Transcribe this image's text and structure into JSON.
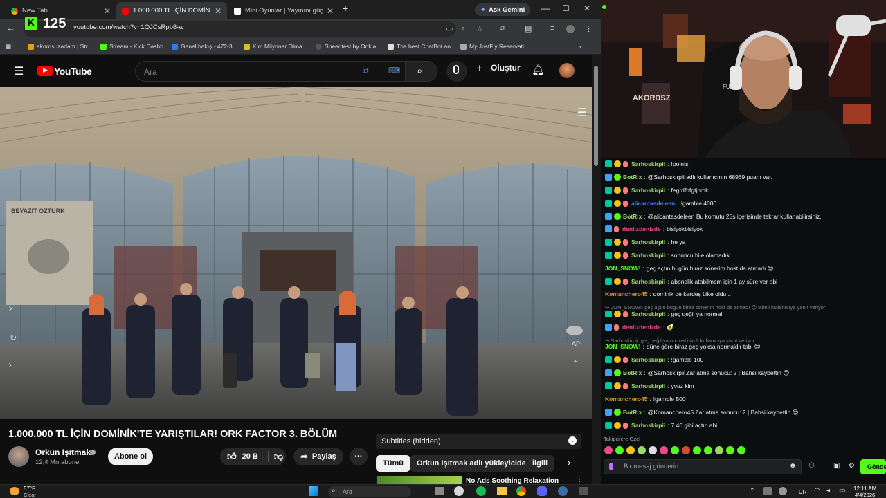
{
  "browser": {
    "tabs": [
      {
        "title": "New Tab",
        "active": false
      },
      {
        "title": "1.000.000 TL İÇİN DOMİNİK'TE",
        "active": true
      },
      {
        "title": "Mini Oyunlar | Yayınını güçlend",
        "active": false
      }
    ],
    "new_tab_symbol": "+",
    "gemini_label": "Ask Gemini",
    "url": "youtube.com/watch?v=1QJCsRpb8-w",
    "bookmarks": [
      "akordsuzadam | Str...",
      "Stream - Kick Dashb...",
      "Genel bakış - 472-3...",
      "Kim Milyoner Olma...",
      "Speedtest by Ookla...",
      "The best ChatBot an...",
      "My JustFly Reservati..."
    ]
  },
  "kick_overlay": {
    "logo": "K",
    "count": "125"
  },
  "youtube": {
    "logo_text": "YouTube",
    "search_placeholder": "Ara",
    "create_label": "Oluştur",
    "video_title": "1.000.000 TL İÇİN DOMİNİK'TE YARIŞTILAR! ORK FACTOR 3. BÖLÜM",
    "channel_name": "Orkun Işıtmak",
    "subscribers": "12,4 Mn abone",
    "subscribe_label": "Abone ol",
    "likes": "20 B",
    "share_label": "Paylaş",
    "subtitles_label": "Subtitles (hidden)",
    "chips": [
      "Tümü",
      "Orkun Işıtmak adlı yükleyiciden",
      "İlgili"
    ],
    "rec_title": "No Ads Soothing Relaxation",
    "video_overlay": {
      "ap": "AP"
    },
    "poster_text": "BEYAZIT ÖZTÜRK"
  },
  "chat": {
    "messages": [
      {
        "user": "Sarhoskirpii",
        "text": "!points",
        "color": "#9bd96b",
        "badges": [
          "mod",
          "coin",
          "sub"
        ]
      },
      {
        "user": "BotRix",
        "text": "@Sarhoskirpii adlı kullanıcının 68969 puanı var.",
        "color": "#9bd96b",
        "badges": [
          "bot",
          "verified"
        ]
      },
      {
        "user": "Sarhoskirpii",
        "text": "fegrdfhfgtjhmk",
        "color": "#9bd96b",
        "badges": [
          "mod",
          "coin",
          "sub"
        ]
      },
      {
        "user": "alicantasdeleen",
        "text": "!gamble 4000",
        "color": "#3f7dff",
        "badges": [
          "mod",
          "coin",
          "sub"
        ]
      },
      {
        "user": "BotRix",
        "text": "@alicantasdeleen Bu komutu 25s içerisinde tekrar kullanabilirsiniz.",
        "color": "#9bd96b",
        "badges": [
          "bot",
          "verified"
        ]
      },
      {
        "user": "deniizdenizde",
        "text": "bisiyokbisiyok",
        "color": "#e84a8a",
        "badges": [
          "bot",
          "sub"
        ]
      },
      {
        "user": "Sarhoskirpii",
        "text": "he ya",
        "color": "#9bd96b",
        "badges": [
          "mod",
          "coin",
          "sub"
        ]
      },
      {
        "user": "Sarhoskirpii",
        "text": "sonuncu bile olamadık",
        "color": "#9bd96b",
        "badges": [
          "mod",
          "coin",
          "sub"
        ]
      },
      {
        "user": "JON_SNOW!",
        "text": "geç açtın bugün biraz sonerim host da atmadı 😊",
        "color": "#53fc18",
        "badges": []
      },
      {
        "user": "Sarhoskirpii",
        "text": "abonelik atabilmem için 1 ay süre ver abi",
        "color": "#9bd96b",
        "badges": [
          "mod",
          "coin",
          "sub"
        ]
      },
      {
        "user": "Komanchero45",
        "text": "dominik de kardeş ülke oldu ...",
        "color": "#d89a2a",
        "badges": []
      }
    ],
    "reply1": "↪ JON_SNOW!: geç açtın bugün biraz sonerim host da atmadı 😊 isimli kullanıcıya yanıt veriyor",
    "messages2": [
      {
        "user": "Sarhoskirpii",
        "text": "geç değil ya normal",
        "color": "#9bd96b",
        "badges": [
          "mod",
          "coin",
          "sub"
        ]
      },
      {
        "user": "deniizdenizde",
        "text": "🥑",
        "color": "#e84a8a",
        "badges": [
          "bot",
          "sub"
        ]
      }
    ],
    "reply2": "↪ Sarhoskirpii: geç değil ya normal isimli kullanıcıya yanıt veriyor",
    "messages3": [
      {
        "user": "JON_SNOW!",
        "text": "düne göre biraz geç yoksa normaldir tabi 😊",
        "color": "#53fc18",
        "badges": []
      },
      {
        "user": "Sarhoskirpii",
        "text": "!gamble 100",
        "color": "#9bd96b",
        "badges": [
          "mod",
          "coin",
          "sub"
        ]
      },
      {
        "user": "BotRix",
        "text": "@Sarhoskirpii Zar atma sonucu: 2 | Bahsi kaybettin 😊",
        "color": "#9bd96b",
        "badges": [
          "bot",
          "verified"
        ]
      },
      {
        "user": "Sarhoskirpii",
        "text": "yvuz kim",
        "color": "#9bd96b",
        "badges": [
          "mod",
          "coin",
          "sub"
        ]
      },
      {
        "user": "Komanchero45",
        "text": "!gamble 500",
        "color": "#d89a2a",
        "badges": []
      },
      {
        "user": "BotRix",
        "text": "@Komanchero45 Zar atma sonucu: 2 | Bahsi kaybettin 😊",
        "color": "#9bd96b",
        "badges": [
          "bot",
          "verified"
        ]
      },
      {
        "user": "Sarhoskirpii",
        "text": "7.40 gibi açtın abi",
        "color": "#9bd96b",
        "badges": [
          "mod",
          "coin",
          "sub"
        ]
      }
    ],
    "emotes_label": "Takipçilere Özel",
    "input_placeholder": "Bir mesaj gönderin",
    "send_label": "Gönde"
  },
  "webcam": {
    "sign": "AKORDSZ",
    "headset": "FURY"
  },
  "taskbar": {
    "weather_temp": "57°F",
    "weather_desc": "Clear",
    "search_label": "Ara",
    "lang": "TUR",
    "time": "12:11 AM",
    "date": "4/4/2026"
  }
}
